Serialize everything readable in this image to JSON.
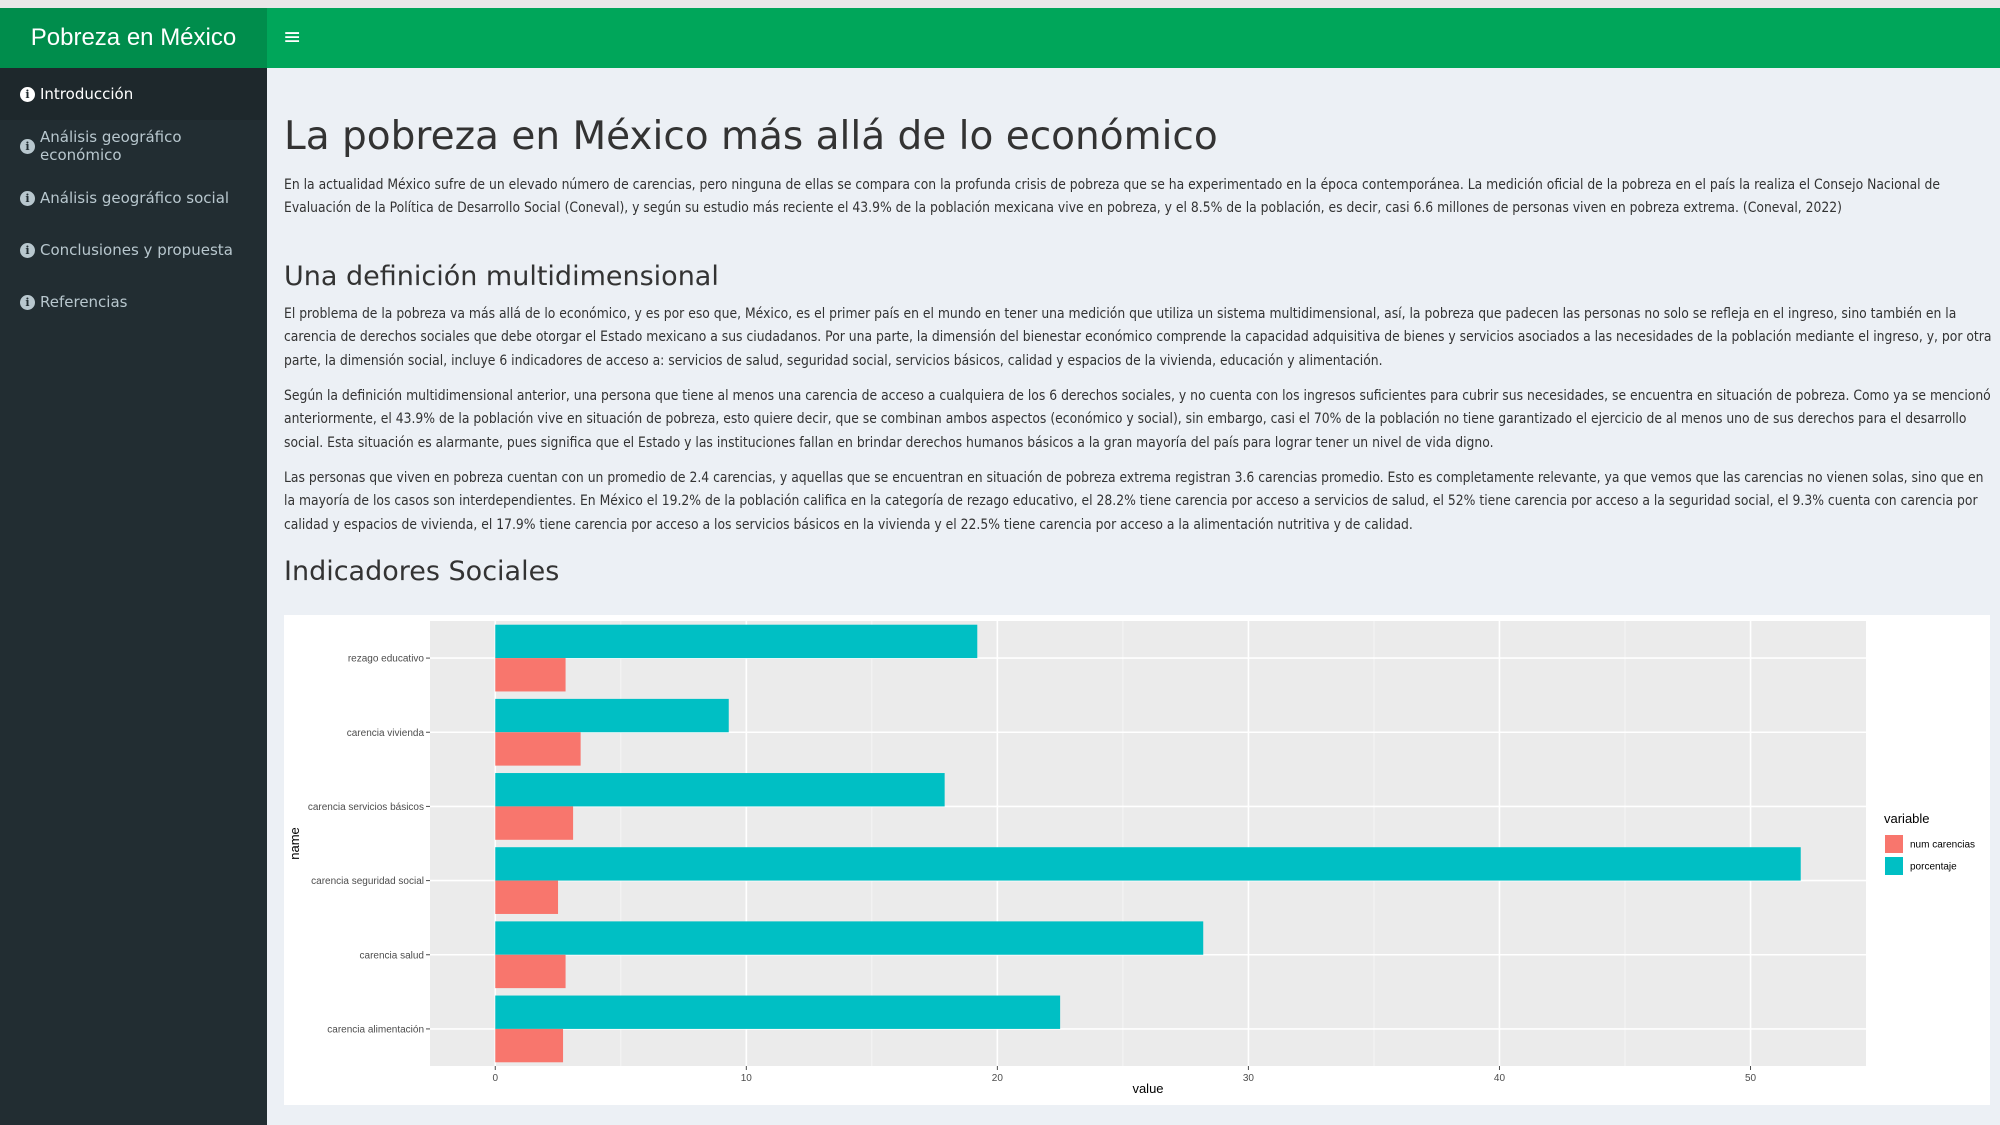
{
  "app": {
    "title": "Pobreza en México"
  },
  "sidebar": {
    "items": [
      {
        "label": "Introducción",
        "active": true
      },
      {
        "label": "Análisis geográfico económico",
        "active": false
      },
      {
        "label": "Análisis geográfico social",
        "active": false
      },
      {
        "label": "Conclusiones y propuesta",
        "active": false
      },
      {
        "label": "Referencias",
        "active": false
      }
    ]
  },
  "header": {
    "menu_icon": "hamburger-icon"
  },
  "main": {
    "title": "La pobreza en México más allá de lo económico",
    "intro": "En la actualidad México sufre de un elevado número de carencias, pero ninguna de ellas se compara con la profunda crisis de pobreza que se ha experimentado en la época contemporánea. La medición oficial de la pobreza en el país la realiza el Consejo Nacional de Evaluación de la Política de Desarrollo Social (Coneval), y según su estudio más reciente el 43.9% de la población mexicana vive en pobreza, y el 8.5% de la población, es decir, casi 6.6 millones de personas viven en pobreza extrema. (Coneval, 2022)",
    "section1_title": "Una definición multidimensional",
    "section1_p1": "El problema de la pobreza va más allá de lo económico, y es por eso que, México, es el primer país en el mundo en tener una medición que utiliza un sistema multidimensional, así, la pobreza que padecen las personas no solo se refleja en el ingreso, sino también en la carencia de derechos sociales que debe otorgar el Estado mexicano a sus ciudadanos. Por una parte, la dimensión del bienestar económico comprende la capacidad adquisitiva de bienes y servicios asociados a las necesidades de la población mediante el ingreso, y, por otra parte, la dimensión social, incluye 6 indicadores de acceso a: servicios de salud, seguridad social, servicios básicos, calidad y espacios de la vivienda, educación y alimentación.",
    "section1_p2": "Según la definición multidimensional anterior, una persona que tiene al menos una carencia de acceso a cualquiera de los 6 derechos sociales, y no cuenta con los ingresos suficientes para cubrir sus necesidades, se encuentra en situación de pobreza. Como ya se mencionó anteriormente, el 43.9% de la población vive en situación de pobreza, esto quiere decir, que se combinan ambos aspectos (económico y social), sin embargo, casi el 70% de la población no tiene garantizado el ejercicio de al menos uno de sus derechos para el desarrollo social. Esta situación es alarmante, pues significa que el Estado y las instituciones fallan en brindar derechos humanos básicos a la gran mayoría del país para lograr tener un nivel de vida digno.",
    "section1_p3": "Las personas que viven en pobreza cuentan con un promedio de 2.4 carencias, y aquellas que se encuentran en situación de pobreza extrema registran 3.6 carencias promedio. Esto es completamente relevante, ya que vemos que las carencias no vienen solas, sino que en la mayoría de los casos son interdependientes. En México el 19.2% de la población califica en la categoría de rezago educativo, el 28.2% tiene carencia por acceso a servicios de salud, el 52% tiene carencia por acceso a la seguridad social, el 9.3% cuenta con carencia por calidad y espacios de vivienda, el 17.9% tiene carencia por acceso a los servicios básicos en la vivienda y el 22.5% tiene carencia por acceso a la alimentación nutritiva y de calidad.",
    "section2_title": "Indicadores Sociales"
  },
  "chart_data": {
    "type": "bar",
    "orientation": "horizontal",
    "categories": [
      "rezago educativo",
      "carencia vivienda",
      "carencia servicios básicos",
      "carencia seguridad social",
      "carencia salud",
      "carencia alimentación"
    ],
    "series": [
      {
        "name": "porcentaje",
        "values": [
          19.2,
          9.3,
          17.9,
          52,
          28.2,
          22.5
        ],
        "color": "#00bfc4"
      },
      {
        "name": "num carencias",
        "values": [
          2.8,
          3.4,
          3.1,
          2.5,
          2.8,
          2.7
        ],
        "color": "#f8766d"
      }
    ],
    "xlabel": "value",
    "ylabel": "name",
    "xlim": [
      -2.6,
      54.6
    ],
    "xticks": [
      0,
      10,
      20,
      30,
      40,
      50
    ],
    "legend_title": "variable",
    "legend": [
      "num carencias",
      "porcentaje"
    ],
    "legend_position": "right",
    "grid": true,
    "panel_color": "#ebebeb"
  }
}
